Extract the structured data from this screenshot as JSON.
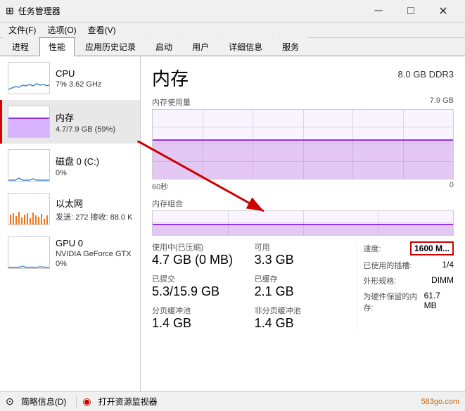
{
  "titlebar": {
    "icon": "⚙",
    "title": "任务管理器",
    "minimize": "─",
    "maximize": "□",
    "close": "✕"
  },
  "menubar": {
    "items": [
      "文件(F)",
      "选项(O)",
      "查看(V)"
    ]
  },
  "tabs": {
    "items": [
      "进程",
      "性能",
      "应用历史记录",
      "启动",
      "用户",
      "详细信息",
      "服务"
    ],
    "active": 1
  },
  "sidebar": {
    "items": [
      {
        "id": "cpu",
        "label": "CPU",
        "value": "7% 3.62 GHz",
        "chartType": "cpu"
      },
      {
        "id": "memory",
        "label": "内存",
        "value": "4.7/7.9 GB (59%)",
        "chartType": "memory",
        "active": true
      },
      {
        "id": "disk",
        "label": "磁盘 0 (C:)",
        "value": "0%",
        "chartType": "disk"
      },
      {
        "id": "network",
        "label": "以太网",
        "value": "发送: 272  接收: 88.0 K",
        "chartType": "network"
      },
      {
        "id": "gpu",
        "label": "GPU 0",
        "value": "NVIDIA GeForce GTX",
        "value2": "0%",
        "chartType": "gpu"
      }
    ]
  },
  "detail": {
    "title": "内存",
    "subtitle": "8.0 GB DDR3",
    "chart_top_label": "内存使用量",
    "chart_top_right": "7.9 GB",
    "chart_time_left": "60秒",
    "chart_time_right": "0",
    "combo_label": "内存组合",
    "stats": {
      "used_label": "使用中(已压缩)",
      "used_value": "4.7 GB (0 MB)",
      "available_label": "可用",
      "available_value": "3.3 GB",
      "committed_label": "已提交",
      "committed_value": "5.3/15.9 GB",
      "cached_label": "已缓存",
      "cached_value": "2.1 GB",
      "paged_label": "分页缓冲池",
      "paged_value": "1.4 GB",
      "nonpaged_label": "非分页缓冲池",
      "nonpaged_value": "1.4 GB"
    },
    "right_stats": {
      "speed_label": "速度:",
      "speed_value": "1600 M...",
      "slots_label": "已使用的插槽:",
      "slots_value": "1/4",
      "form_label": "外形规格:",
      "form_value": "DIMM",
      "reserved_label": "为硬件保留的内存:",
      "reserved_value": "61.7 MB"
    }
  },
  "statusbar": {
    "brief_label": "简略信息(D)",
    "monitor_label": "打开资源监视器",
    "watermark": "583go.com"
  }
}
